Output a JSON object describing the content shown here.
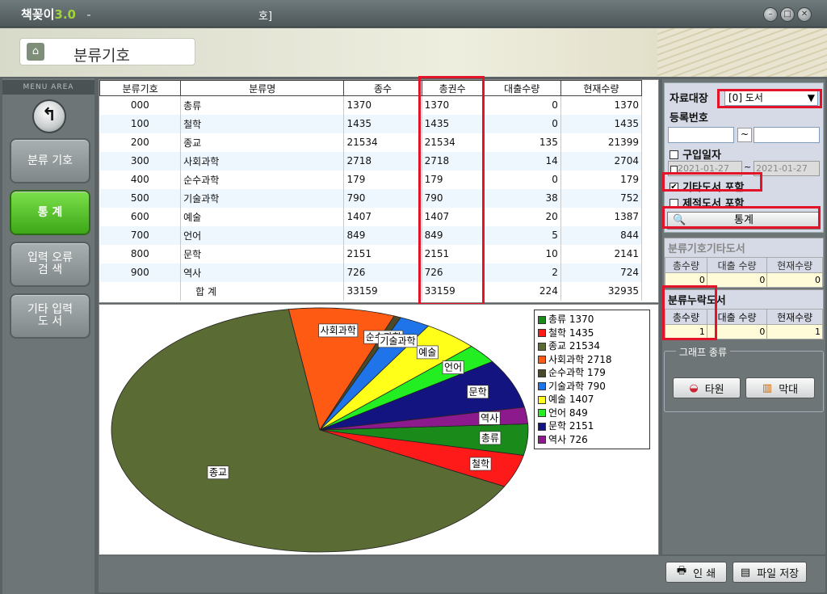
{
  "window": {
    "app_name": "책꽂이",
    "app_version": "3.0",
    "title_dash": "-",
    "title_center": "호]"
  },
  "header": {
    "page_title": "분류기호"
  },
  "sidebar": {
    "menu_area": "MENU AREA",
    "back_glyph": "↰",
    "items": [
      {
        "label": "분류 기호",
        "active": false
      },
      {
        "label": "통    계",
        "active": true
      },
      {
        "label": "입력 오류\n검    색",
        "active": false
      },
      {
        "label": "기타 입력\n도    서",
        "active": false
      }
    ]
  },
  "table": {
    "columns": [
      "분류기호",
      "분류명",
      "종수",
      "총권수",
      "대출수량",
      "현재수량"
    ],
    "rows": [
      [
        "000",
        "총류",
        "1370",
        "1370",
        "0",
        "1370"
      ],
      [
        "100",
        "철학",
        "1435",
        "1435",
        "0",
        "1435"
      ],
      [
        "200",
        "종교",
        "21534",
        "21534",
        "135",
        "21399"
      ],
      [
        "300",
        "사회과학",
        "2718",
        "2718",
        "14",
        "2704"
      ],
      [
        "400",
        "순수과학",
        "179",
        "179",
        "0",
        "179"
      ],
      [
        "500",
        "기술과학",
        "790",
        "790",
        "38",
        "752"
      ],
      [
        "600",
        "예술",
        "1407",
        "1407",
        "20",
        "1387"
      ],
      [
        "700",
        "언어",
        "849",
        "849",
        "5",
        "844"
      ],
      [
        "800",
        "문학",
        "2151",
        "2151",
        "10",
        "2141"
      ],
      [
        "900",
        "역사",
        "726",
        "726",
        "2",
        "724"
      ],
      [
        "",
        "합  계",
        "33159",
        "33159",
        "224",
        "32935"
      ]
    ]
  },
  "chart_data": {
    "type": "pie",
    "categories": [
      "총류",
      "철학",
      "종교",
      "사회과학",
      "순수과학",
      "기술과학",
      "예술",
      "언어",
      "문학",
      "역사"
    ],
    "values": [
      1370,
      1435,
      21534,
      2718,
      179,
      790,
      1407,
      849,
      2151,
      726
    ],
    "legend": [
      "총류 1370",
      "철학 1435",
      "종교 21534",
      "사회과학 2718",
      "순수과학 179",
      "기술과학 790",
      "예술 1407",
      "언어 849",
      "문학 2151",
      "역사 726"
    ],
    "colors": [
      "#1a8a1a",
      "#ff1a1a",
      "#5a6b33",
      "#ff5a14",
      "#4a4a2a",
      "#1e74e8",
      "#ffff1a",
      "#22ee22",
      "#141480",
      "#8c1a8c"
    ],
    "legend_position": "right"
  },
  "right_panel": {
    "jaryo_label": "자료대장",
    "jaryo_value": "[0] 도서",
    "reg_label": "등록번호",
    "tilde": "~",
    "purchase_label": "구입일자",
    "date_from": "2021-01-27",
    "date_to": "2021-01-27",
    "etc_label": "기타도서 포함",
    "remove_label": "제적도서 포함",
    "stats_button": "통계",
    "etc_box_title": "분류기호기타도서",
    "etc_cols": [
      "총수량",
      "대출 수량",
      "현재수량"
    ],
    "etc_vals": [
      "0",
      "0",
      "0"
    ],
    "missing_box_title": "분류누락도서",
    "missing_cols": [
      "총수량",
      "대출 수량",
      "현재수량"
    ],
    "missing_vals": [
      "1",
      "0",
      "1"
    ],
    "graph_title": "그래프 종류",
    "pie_button": "타원",
    "bar_button": "막대"
  },
  "bottom": {
    "print_button": "인  쇄",
    "save_button": "파일 저장"
  }
}
